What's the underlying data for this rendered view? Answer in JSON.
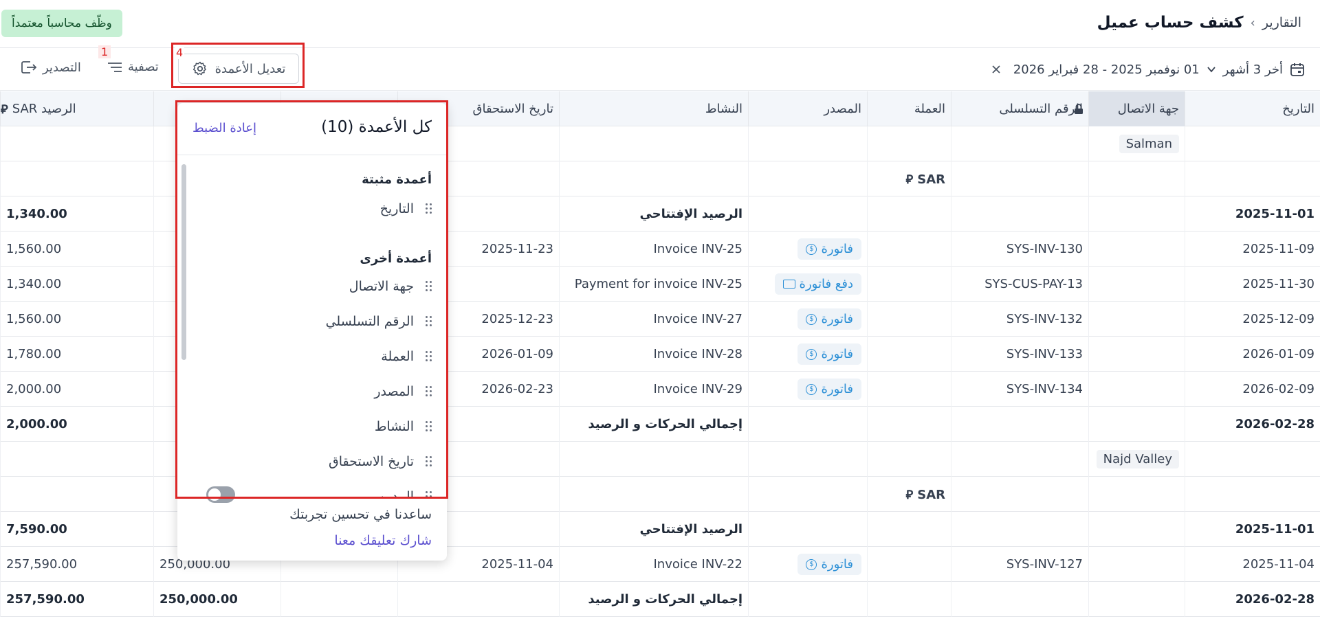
{
  "header": {
    "breadcrumb_parent": "التقارير",
    "breadcrumb_sep": "›",
    "title": "كشف حساب عميل",
    "hire_button": "وظّف محاسباً معتمداً"
  },
  "toolbar": {
    "date_preset": "أخر 3 أشهر",
    "date_range": "01 نوفمبر 2025 - 28 فبراير 2026",
    "export_label": "التصدير",
    "filter_label": "تصفية",
    "filter_badge": "1",
    "columns_label": "تعديل الأعمدة",
    "columns_badge": "4"
  },
  "table": {
    "headers": {
      "date": "التاريخ",
      "contact": "جهة الاتصال",
      "serial": "الرقم التسلسلى",
      "currency": "العملة",
      "source": "المصدر",
      "activity": "النشاط",
      "due_date": "تاريخ الاستحقاق",
      "balance": "الرصيد SAR"
    },
    "currency_symbol": "⃁",
    "rows": [
      {
        "type": "contact",
        "contact": "Salman"
      },
      {
        "type": "currency",
        "currency": "SAR"
      },
      {
        "type": "total",
        "date": "2025-11-01",
        "activity": "الرصيد الإفتتاحي",
        "balance": "1,340.00"
      },
      {
        "type": "entry",
        "date": "2025-11-09",
        "serial": "SYS-INV-130",
        "source": "فاتورة",
        "activity": "Invoice INV-25",
        "due": "2025-11-23",
        "balance": "1,560.00"
      },
      {
        "type": "entry",
        "date": "2025-11-30",
        "serial": "SYS-CUS-PAY-13",
        "source": "دفع فاتورة",
        "activity": "Payment for invoice INV-25",
        "due": "",
        "balance": "1,340.00"
      },
      {
        "type": "entry",
        "date": "2025-12-09",
        "serial": "SYS-INV-132",
        "source": "فاتورة",
        "activity": "Invoice INV-27",
        "due": "2025-12-23",
        "balance": "1,560.00"
      },
      {
        "type": "entry",
        "date": "2026-01-09",
        "serial": "SYS-INV-133",
        "source": "فاتورة",
        "activity": "Invoice INV-28",
        "due": "2026-01-09",
        "balance": "1,780.00"
      },
      {
        "type": "entry",
        "date": "2026-02-09",
        "serial": "SYS-INV-134",
        "source": "فاتورة",
        "activity": "Invoice INV-29",
        "due": "2026-02-23",
        "balance": "2,000.00"
      },
      {
        "type": "total",
        "date": "2026-02-28",
        "activity": "إجمالي الحركات و الرصيد",
        "balance": "2,000.00"
      },
      {
        "type": "contact",
        "contact": "Najd Valley"
      },
      {
        "type": "currency",
        "currency": "SAR"
      },
      {
        "type": "total",
        "date": "2025-11-01",
        "activity": "الرصيد الإفتتاحي",
        "balance": "7,590.00"
      },
      {
        "type": "entry",
        "date": "2025-11-04",
        "serial": "SYS-INV-127",
        "source": "فاتورة",
        "activity": "Invoice INV-22",
        "due": "2025-11-04",
        "balance": "257,590.00",
        "hidden_amount": "250,000.00"
      },
      {
        "type": "total",
        "date": "2026-02-28",
        "activity": "إجمالي الحركات و الرصيد",
        "balance": "257,590.00",
        "hidden_amount": "250,000.00"
      }
    ]
  },
  "columns_popover": {
    "title": "كل الأعمدة (10)",
    "reset": "إعادة الضبط",
    "pinned_label": "أعمدة مثبتة",
    "pinned": [
      "التاريخ"
    ],
    "others_label": "أعمدة أخرى",
    "others": [
      "جهة الاتصال",
      "الرقم التسلسلي",
      "العملة",
      "المصدر",
      "النشاط",
      "تاريخ الاستحقاق",
      "المدين"
    ],
    "feedback_text": "ساعدنا في تحسين تجربتك",
    "feedback_link": "شارك تعليقك معنا"
  }
}
